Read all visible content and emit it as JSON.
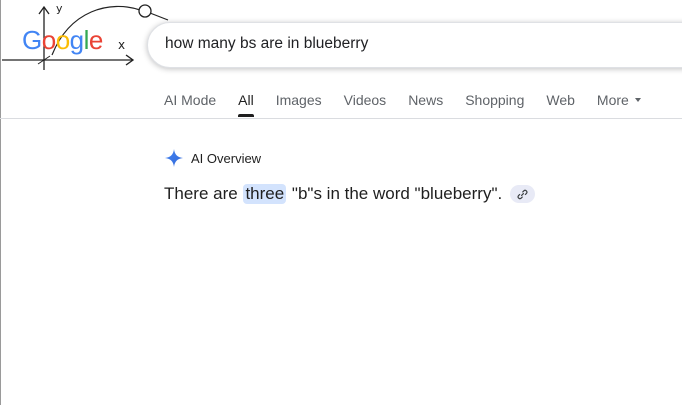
{
  "logo": {
    "letters": [
      "G",
      "o",
      "o",
      "g",
      "l",
      "e"
    ],
    "colors": [
      "#4285f4",
      "#ea4335",
      "#fbbc05",
      "#4285f4",
      "#34a853",
      "#ea4335"
    ],
    "doodle_marks": [
      "y",
      "x"
    ]
  },
  "search": {
    "query": "how many bs are in blueberry"
  },
  "tabs": [
    {
      "label": "AI Mode",
      "active": false
    },
    {
      "label": "All",
      "active": true
    },
    {
      "label": "Images",
      "active": false
    },
    {
      "label": "Videos",
      "active": false
    },
    {
      "label": "News",
      "active": false
    },
    {
      "label": "Shopping",
      "active": false
    },
    {
      "label": "Web",
      "active": false
    },
    {
      "label": "More",
      "active": false
    }
  ],
  "ai_overview": {
    "title": "AI Overview",
    "answer_before": "There are",
    "answer_highlight": "three",
    "answer_after": "\"b\"s in the word \"blueberry\".",
    "icons": [
      "sparkle-icon",
      "link-icon"
    ]
  },
  "colors": {
    "accent": "#4285f4",
    "highlight": "#d3e3fd",
    "chip": "#e8eaf6"
  }
}
